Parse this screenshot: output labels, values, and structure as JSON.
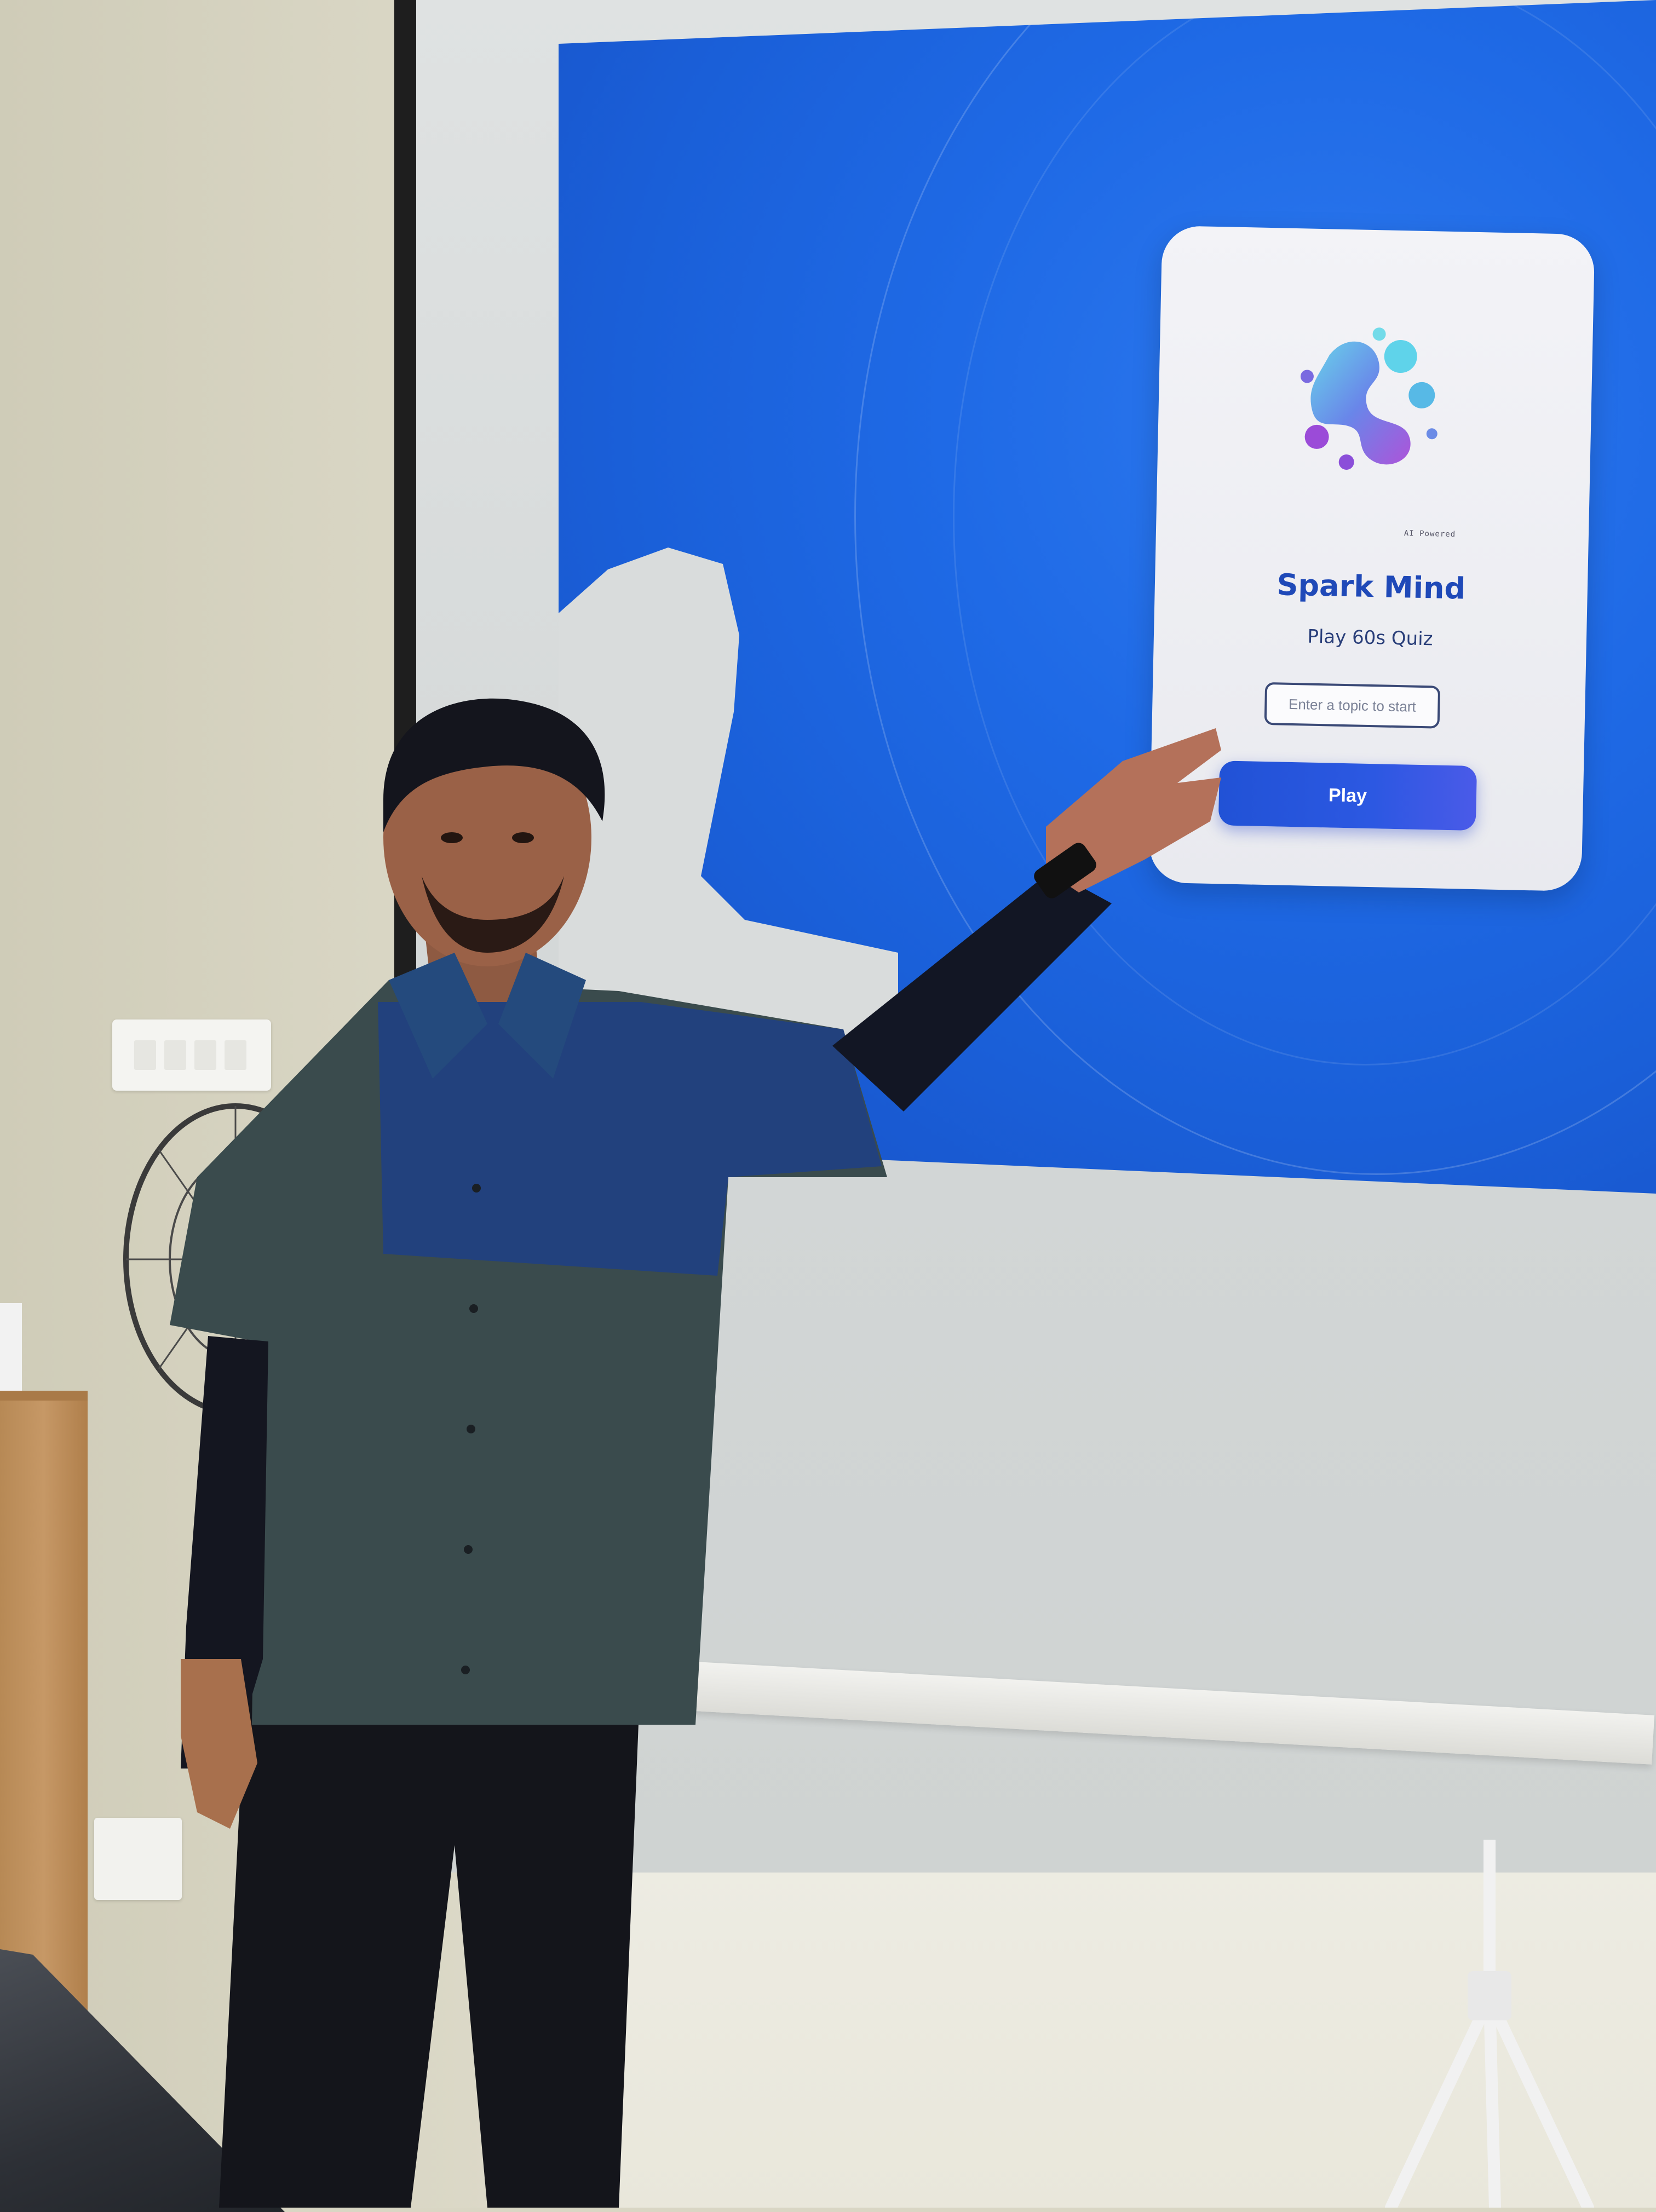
{
  "screen_card": {
    "ai_tag": "AI Powered",
    "title": "Spark Mind",
    "subtitle": "Play 60s Quiz",
    "topic_placeholder": "Enter a topic to start",
    "play_label": "Play"
  },
  "colors": {
    "projection_blue": "#1f6ae6",
    "title_blue": "#1f49b8",
    "button_blue": "#2152d6",
    "card_bg": "#f0f1f5"
  },
  "icons": {
    "app_logo": "spark-mind-logo-icon"
  }
}
